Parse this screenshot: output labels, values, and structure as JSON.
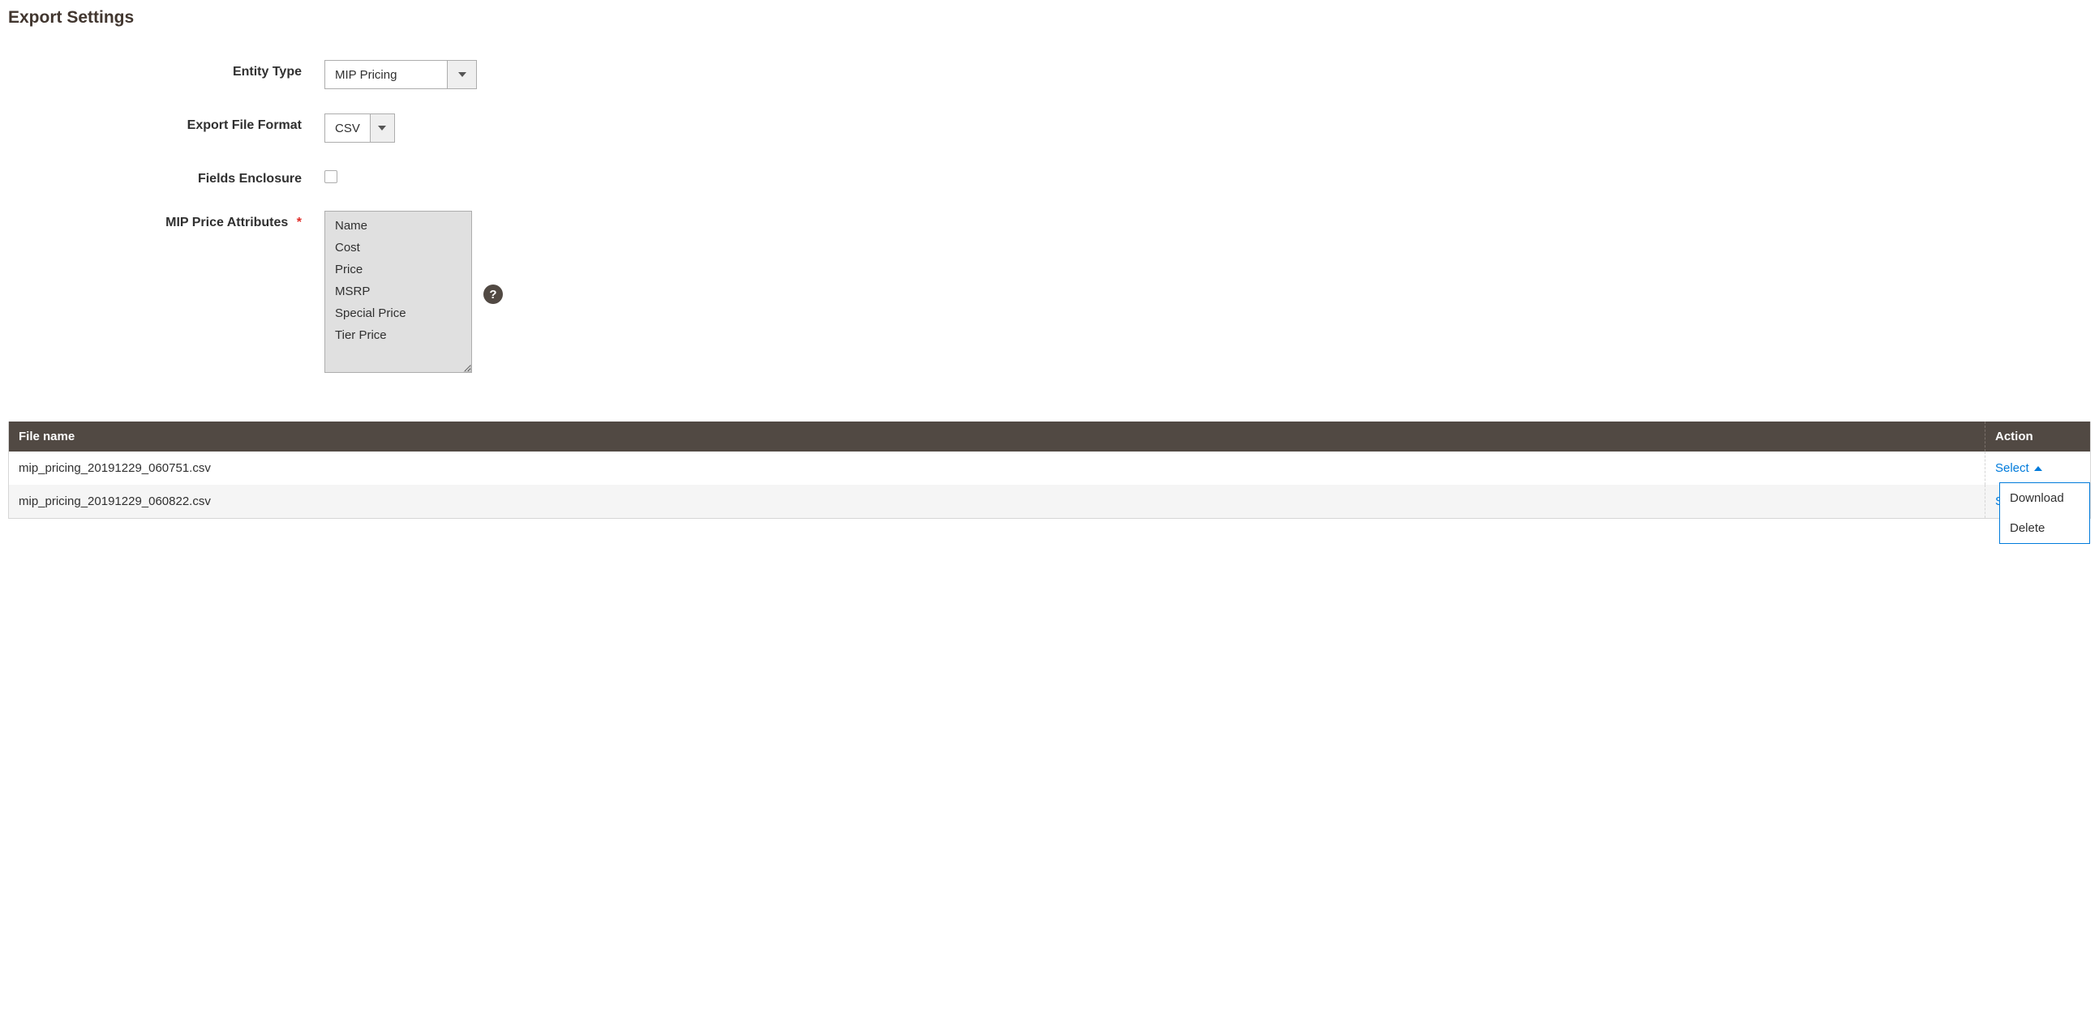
{
  "page": {
    "title": "Export Settings"
  },
  "form": {
    "entity_type": {
      "label": "Entity Type",
      "value": "MIP Pricing"
    },
    "file_format": {
      "label": "Export File Format",
      "value": "CSV"
    },
    "fields_enclosure": {
      "label": "Fields Enclosure",
      "checked": false
    },
    "attributes": {
      "label": "MIP Price Attributes",
      "options": [
        "Name",
        "Cost",
        "Price",
        "MSRP",
        "Special Price",
        "Tier Price"
      ]
    }
  },
  "table": {
    "headers": {
      "file_name": "File name",
      "action": "Action"
    },
    "rows": [
      {
        "file_name": "mip_pricing_20191229_060751.csv",
        "action_label": "Select",
        "menu_open": true
      },
      {
        "file_name": "mip_pricing_20191229_060822.csv",
        "action_label": "Select",
        "menu_open": false
      }
    ],
    "action_menu": {
      "download": "Download",
      "delete": "Delete"
    }
  }
}
